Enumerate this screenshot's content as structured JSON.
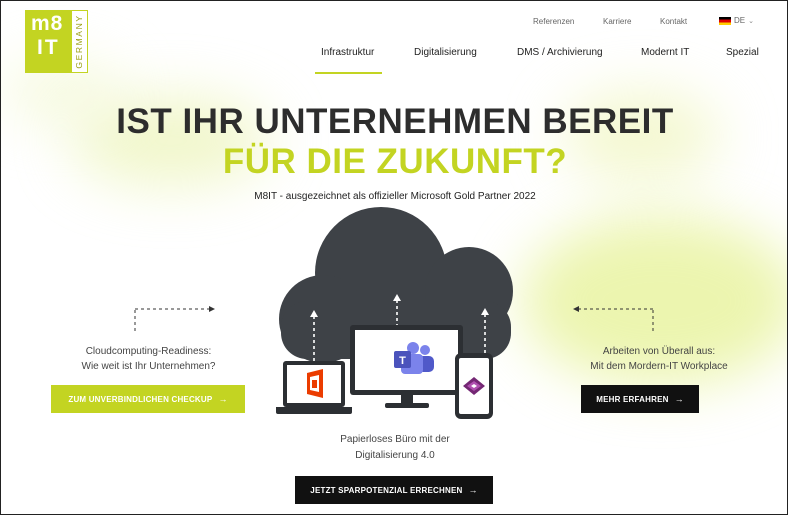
{
  "logo": {
    "line1": "m8",
    "line2": "IT",
    "tagline": "GERMANY"
  },
  "top_nav": {
    "items": [
      "Referenzen",
      "Karriere",
      "Kontakt"
    ],
    "language": "DE"
  },
  "main_nav": {
    "items": [
      "Infrastruktur",
      "Digitalisierung",
      "DMS / Archivierung",
      "Modernt IT",
      "Spezial"
    ],
    "active": "Infrastruktur"
  },
  "hero": {
    "headline_line1": "IST IHR UNTERNEHMEN BEREIT",
    "headline_line2": "FÜR DIE ZUKUNFT?",
    "subtitle": "M8IT - ausgezeichnet als offizieller Microsoft Gold Partner 2022"
  },
  "left_feature": {
    "line1": "Cloudcomputing-Readiness:",
    "line2": "Wie weit ist Ihr Unternehmen?",
    "button": "ZUM UNVERBINDLICHEN CHECKUP"
  },
  "right_feature": {
    "line1": "Arbeiten von Überall aus:",
    "line2": "Mit dem Mordern-IT Workplace",
    "button": "MEHR ERFAHREN"
  },
  "bottom_feature": {
    "line1": "Papierloses Büro mit der",
    "line2": "Digitalisierung 4.0",
    "button": "JETZT SPARPOTENZIAL ERRECHNEN"
  },
  "icons": {
    "arrow": "→",
    "chevron": "⌄",
    "flag": "germany-flag",
    "cloud": "cloud-icon",
    "office": "office-icon",
    "teams": "teams-icon",
    "powerapps": "powerapps-icon"
  },
  "colors": {
    "accent": "#c3d422",
    "dark": "#2d2d2d",
    "cloud": "#3e4247"
  }
}
